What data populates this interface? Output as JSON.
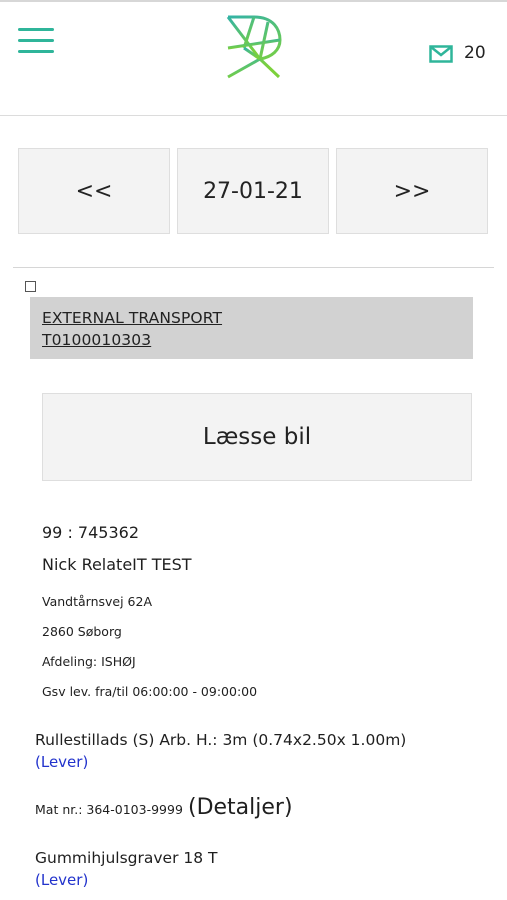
{
  "header": {
    "mail_count": "20",
    "accent_color": "#2fb59a",
    "icons": [
      "menu-icon",
      "logo",
      "mail-icon"
    ]
  },
  "date_nav": {
    "prev_label": "<<",
    "date": "27-01-21",
    "next_label": ">>"
  },
  "transport": {
    "type": "EXTERNAL TRANSPORT",
    "number": "T0100010303",
    "checked": false
  },
  "load_button_label": "Læsse bil",
  "order": {
    "id": "99 : 745362",
    "customer": "Nick RelateIT TEST",
    "address": "Vandtårnsvej 62A",
    "city": "2860 Søborg",
    "department": "Afdeling: ISHØJ",
    "delivery_time": "Gsv lev. fra/til 06:00:00 - 09:00:00"
  },
  "items": [
    {
      "name": "Rullestillads (S) Arb. H.: 3m (0.74x2.50x 1.00m)",
      "action": "(Lever)"
    },
    {
      "name": "Gummihjulsgraver 18 T",
      "action": "(Lever)"
    }
  ],
  "material": {
    "label": "Mat nr.: 364-0103-9999",
    "details_link": "(Detaljer)"
  }
}
